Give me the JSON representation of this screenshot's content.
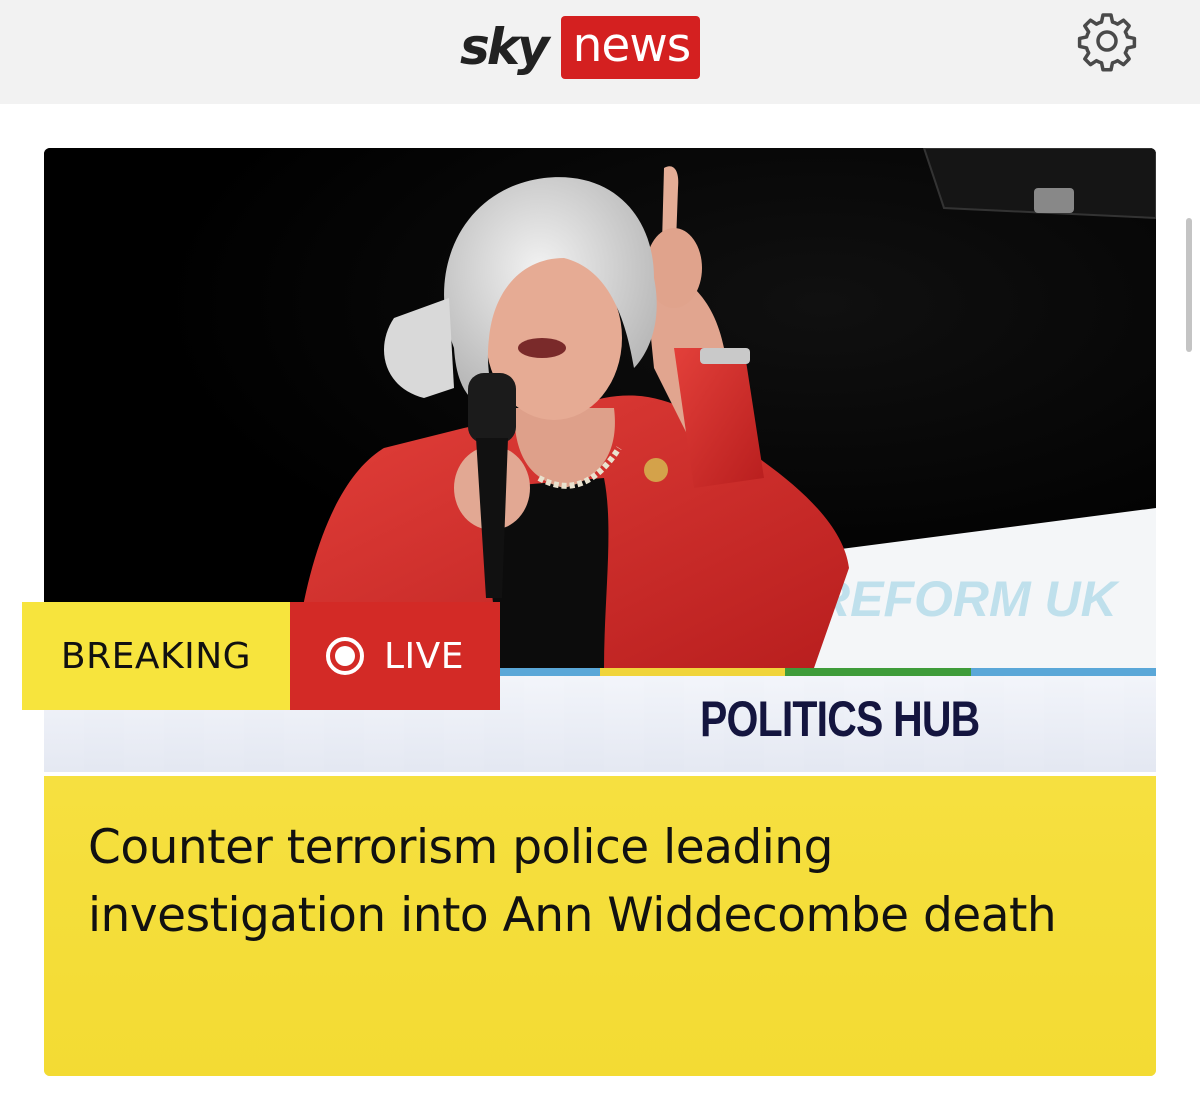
{
  "header": {
    "logo_sky": "sky",
    "logo_news": "news",
    "settings_icon": "gear-icon"
  },
  "story": {
    "badge_breaking": "BREAKING",
    "badge_live": "LIVE",
    "live_icon": "record-icon",
    "hub_label": "POLITICS HUB",
    "headline": "Counter terrorism police leading investigation into Ann Widdecombe death",
    "image_sign_text": "REFORM UK"
  },
  "colors": {
    "brand_red": "#d42020",
    "breaking_yellow": "#f7e43d",
    "live_red": "#d32a26",
    "headline_bg": "#f6df3e",
    "hub_text": "#14153f"
  }
}
